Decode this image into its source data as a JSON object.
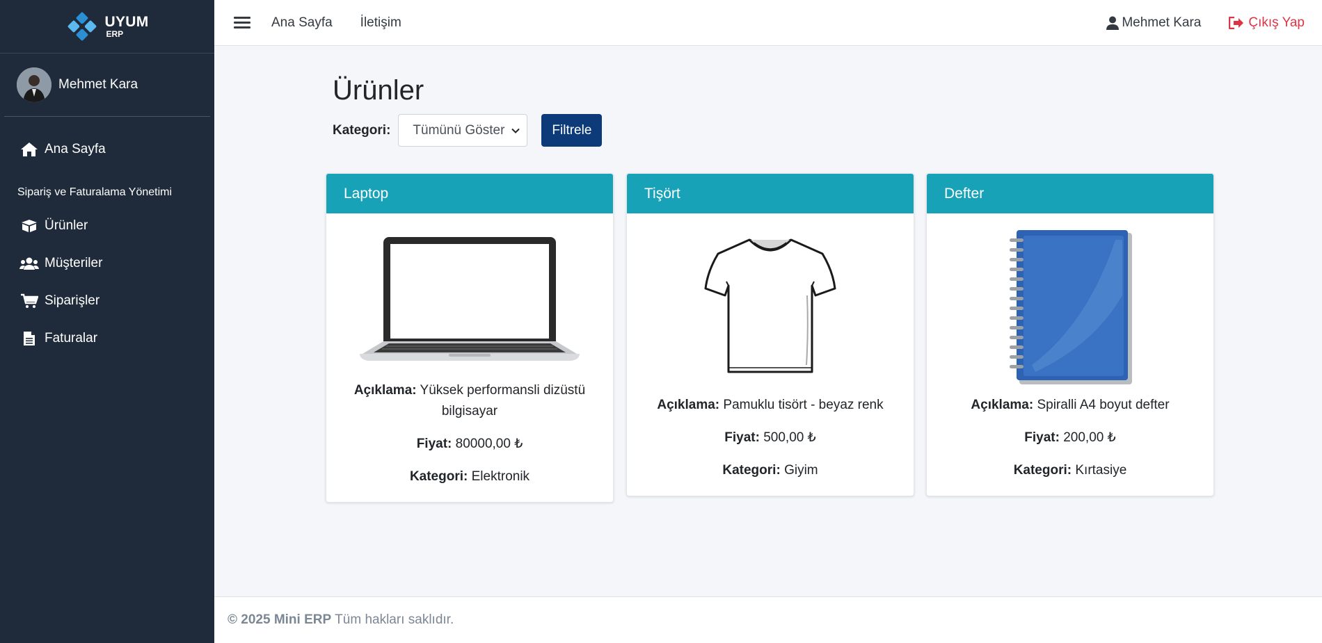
{
  "brand": {
    "name": "UYUM",
    "sub": "ERP"
  },
  "sidebar": {
    "user_name": "Mehmet Kara",
    "home": "Ana Sayfa",
    "section_header": "Sipariş ve Faturalama Yönetimi",
    "items": [
      {
        "label": "Ürünler",
        "icon": "box-icon"
      },
      {
        "label": "Müşteriler",
        "icon": "users-icon"
      },
      {
        "label": "Siparişler",
        "icon": "cart-icon"
      },
      {
        "label": "Faturalar",
        "icon": "invoice-icon"
      }
    ]
  },
  "topbar": {
    "links": [
      "Ana Sayfa",
      "İletişim"
    ],
    "user_name": "Mehmet Kara",
    "logout": "Çıkış Yap"
  },
  "page": {
    "title": "Ürünler",
    "filter_label": "Kategori:",
    "filter_selected": "Tümünü Göster",
    "filter_button": "Filtrele"
  },
  "labels": {
    "description": "Açıklama:",
    "price": "Fiyat:",
    "category": "Kategori:"
  },
  "products": [
    {
      "name": "Laptop",
      "description": "Yüksek performansli dizüstü bilgisayar",
      "price": "80000,00 ₺",
      "category": "Elektronik",
      "image": "laptop-image"
    },
    {
      "name": "Tişört",
      "description": "Pamuklu tisört - beyaz renk",
      "price": "500,00 ₺",
      "category": "Giyim",
      "image": "tshirt-image"
    },
    {
      "name": "Defter",
      "description": "Spiralli A4 boyut defter",
      "price": "200,00 ₺",
      "category": "Kırtasiye",
      "image": "notebook-image"
    }
  ],
  "footer": {
    "copyright": "© 2025 Mini ERP",
    "rights": "Tüm hakları saklıdır."
  },
  "colors": {
    "sidebar": "#1f2a3a",
    "card_header": "#17a2b8",
    "primary_button": "#0d3b7a",
    "logout": "#dc3545"
  }
}
